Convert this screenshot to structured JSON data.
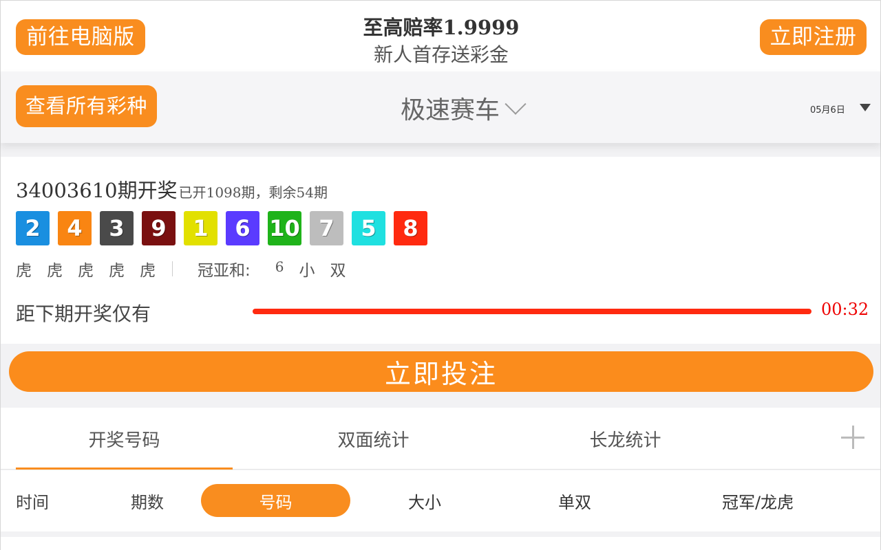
{
  "header": {
    "pc_button": "前往电脑版",
    "promo_title": "至高赔率1.9999",
    "promo_subtitle": "新人首存送彩金",
    "register_button": "立即注册"
  },
  "selector": {
    "all_lotteries_button": "查看所有彩种",
    "game_name": "极速赛车",
    "date": "05月6日"
  },
  "result": {
    "period": "34003610期开奖",
    "period_info": "已开1098期，剩余54期",
    "balls": [
      {
        "num": "2",
        "color": "#1a8fe0"
      },
      {
        "num": "4",
        "color": "#f98512"
      },
      {
        "num": "3",
        "color": "#4a4a4a"
      },
      {
        "num": "9",
        "color": "#7a1010"
      },
      {
        "num": "1",
        "color": "#e2e000"
      },
      {
        "num": "6",
        "color": "#5a3bff"
      },
      {
        "num": "10",
        "color": "#1fb31a"
      },
      {
        "num": "7",
        "color": "#bdbdbd"
      },
      {
        "num": "5",
        "color": "#1fe0e0"
      },
      {
        "num": "8",
        "color": "#ff2a10"
      }
    ],
    "tigers": [
      "虎",
      "虎",
      "虎",
      "虎",
      "虎"
    ],
    "sum_label": "冠亚和:",
    "sum_value": "6",
    "size": "小",
    "parity": "双",
    "countdown_label": "距下期开奖仅有",
    "countdown_progress": 1.0,
    "timer": "00:32"
  },
  "bet_button": "立即投注",
  "tabs": [
    "开奖号码",
    "双面统计",
    "长龙统计"
  ],
  "subtabs": [
    "时间",
    "期数",
    "号码",
    "大小",
    "单双",
    "冠军/龙虎"
  ]
}
